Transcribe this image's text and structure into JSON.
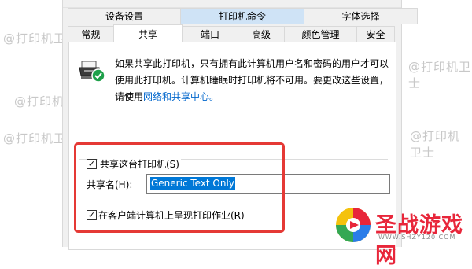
{
  "tabs_row1": [
    {
      "label": "设备设置"
    },
    {
      "label": "打印机命令"
    },
    {
      "label": "字体选择"
    }
  ],
  "tabs_row2": [
    {
      "label": "常规"
    },
    {
      "label": "共享"
    },
    {
      "label": "端口"
    },
    {
      "label": "高级"
    },
    {
      "label": "颜色管理"
    },
    {
      "label": "安全"
    }
  ],
  "info": {
    "text_before_link": "如果共享此打印机，只有拥有此计算机用户名和密码的用户才可以使用此打印机。计算机睡眠时打印机将不可用。要更改这些设置，请使用",
    "link_text": "网络和共享中心。"
  },
  "share_checkbox": {
    "label": "共享这台打印机(S)",
    "checked": "✓"
  },
  "share_name": {
    "label": "共享名(H):",
    "value": "Generic  Text Only"
  },
  "render_checkbox": {
    "label": "在客户端计算机上呈现打印作业(R)",
    "checked": "✓"
  },
  "watermarks": [
    "@打印机卫士",
    "@打印机卫士",
    "@打印机卫士",
    "@打印机卫士",
    "@打印机卫士"
  ],
  "logo": {
    "text": "圣战游戏网",
    "url": "WWW.SHZY120.COM"
  },
  "colors": {
    "accent": "#0078d7",
    "highlight": "#e53935",
    "tab_highlight": "#cfe3f6",
    "link": "#0066cc"
  }
}
